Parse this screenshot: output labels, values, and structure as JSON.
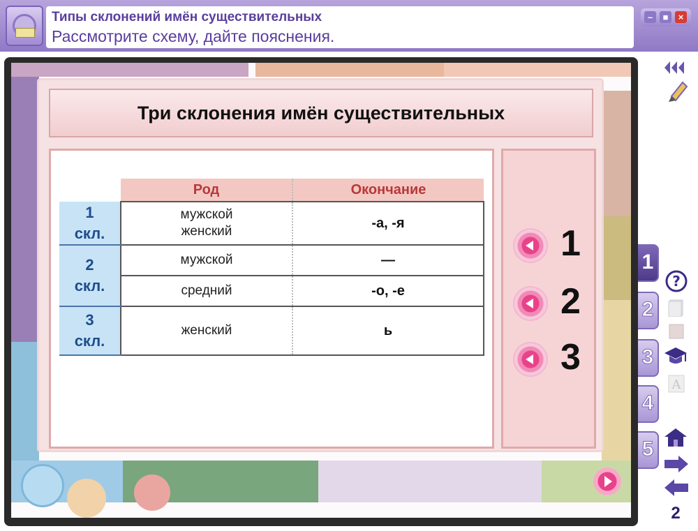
{
  "window": {
    "title": "Типы склонений имён существительных",
    "subtitle": "Рассмотрите схему, дайте пояснения.",
    "buttons": {
      "minimize": "–",
      "maximize": "■",
      "close": "×"
    }
  },
  "slide": {
    "title": "Три склонения имён существительных",
    "table": {
      "headers": [
        "Род",
        "Окончание"
      ],
      "groups": [
        {
          "label_num": "1",
          "label_text": "скл.",
          "rows": [
            {
              "gender": [
                "мужской",
                "женский"
              ],
              "ending": "-а, -я"
            }
          ]
        },
        {
          "label_num": "2",
          "label_text": "скл.",
          "rows": [
            {
              "gender": [
                "мужской"
              ],
              "ending": "—"
            },
            {
              "gender": [
                "средний"
              ],
              "ending": "-о, -е"
            }
          ]
        },
        {
          "label_num": "3",
          "label_text": "скл.",
          "rows": [
            {
              "gender": [
                "женский"
              ],
              "ending": "ь"
            }
          ]
        }
      ]
    },
    "number_buttons": [
      "1",
      "2",
      "3"
    ]
  },
  "sidebar": {
    "tabs": [
      "1",
      "2",
      "3",
      "4",
      "5"
    ],
    "active_tab": "1",
    "icons": [
      "rewind-icon",
      "pencil-icon",
      "help-icon",
      "notes-icon",
      "bookmark-icon",
      "graduation-cap-icon",
      "dictionary-icon",
      "home-icon",
      "next-arrow-icon",
      "prev-arrow-icon"
    ],
    "page_number": "2"
  },
  "colors": {
    "accent_purple": "#8f79c6",
    "title_text": "#5a3e9c",
    "header_bg": "#f4c8c2",
    "header_text": "#b6393b",
    "declension_bg": "#c8e3f6",
    "declension_text": "#1d4d8c",
    "button_pink": "#e8428a"
  }
}
